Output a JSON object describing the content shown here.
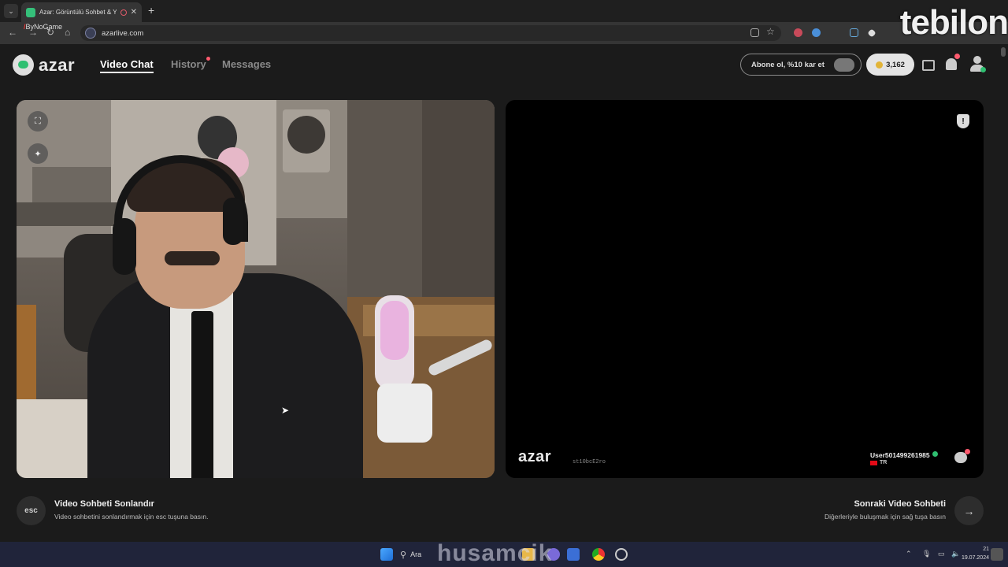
{
  "browser": {
    "tab_title": "Azar: Görüntülü Sohbet & Y",
    "bookmark_label": "ByNoGame",
    "url": "azarlive.com"
  },
  "watermarks": {
    "top_right": "tebilon",
    "taskbar": "husamcik"
  },
  "header": {
    "logo_text": "azar",
    "nav": {
      "video_chat": "Video Chat",
      "history": "History",
      "messages": "Messages"
    },
    "promo_label": "Abone ol, %10 kar et",
    "coin_balance": "3,162",
    "accent_color": "#2fbf71",
    "badge_color": "#ff5a6e"
  },
  "remote_video": {
    "watermark": "azar",
    "session_id": "st10bcE2ro",
    "username": "User501499261985",
    "country_code": "TR"
  },
  "footer": {
    "esc_key": "esc",
    "end_title": "Video Sohbeti Sonlandır",
    "end_subtitle": "Video sohbetini sonlandırmak için esc tuşuna basın.",
    "next_title": "Sonraki Video Sohbeti",
    "next_subtitle": "Diğerleriyle buluşmak için sağ tuşa basın"
  },
  "taskbar": {
    "search_label": "Ara",
    "time": "21",
    "date": "19.07.2024"
  }
}
